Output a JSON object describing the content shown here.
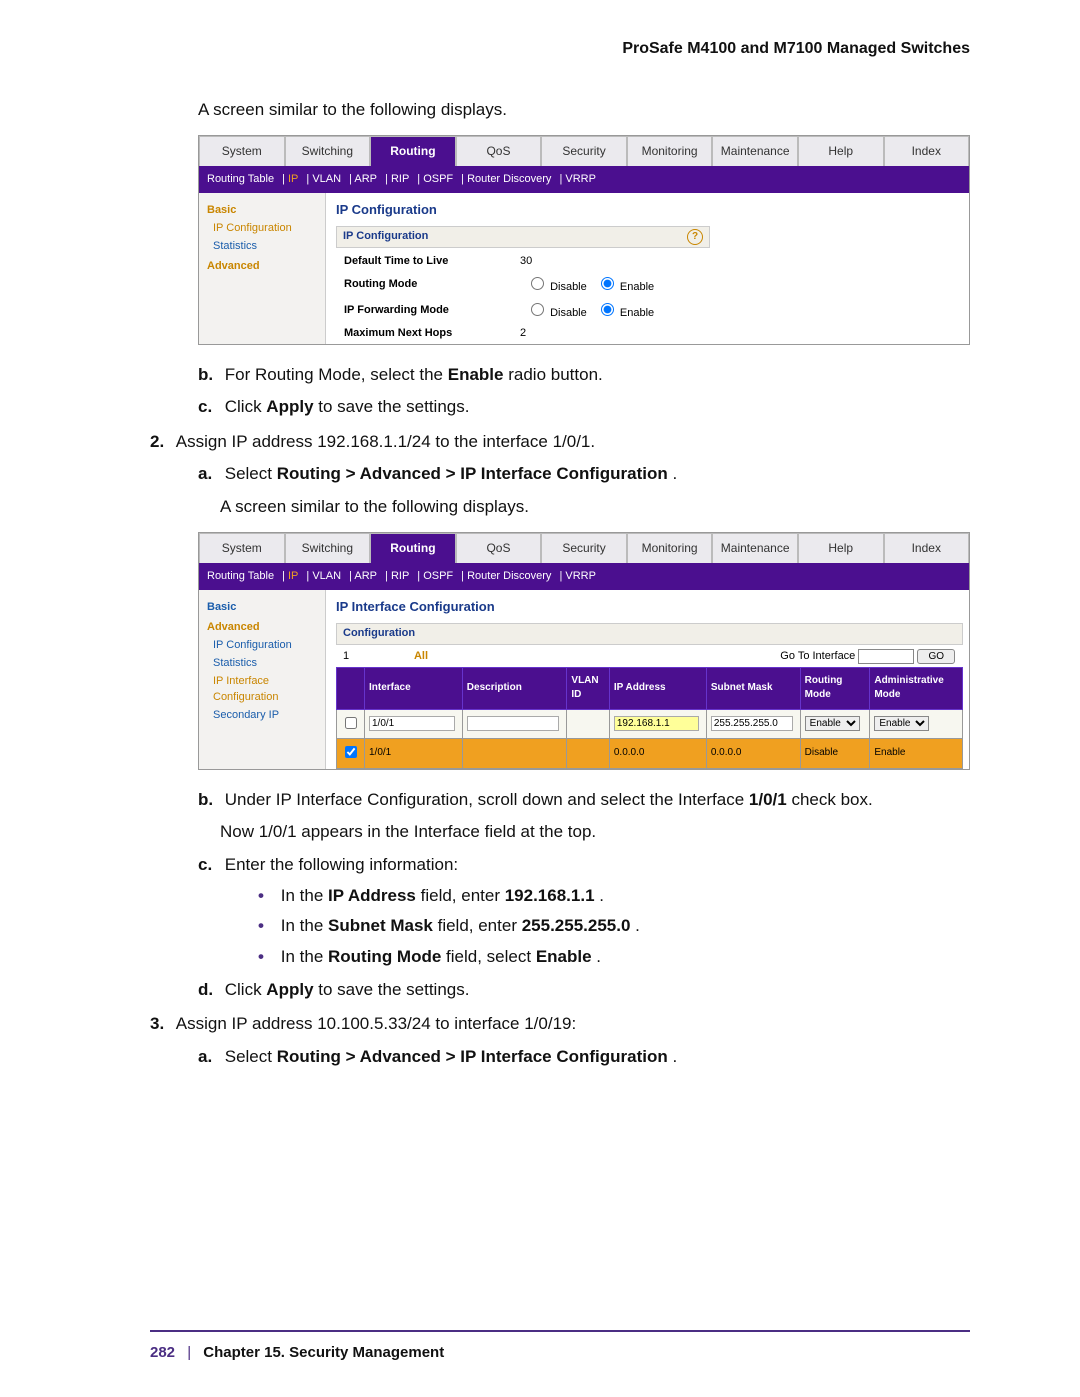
{
  "page": {
    "running_head": "ProSafe M4100 and M7100 Managed Switches",
    "footer_page": "282",
    "footer_chapter": "Chapter 15.  Security Management"
  },
  "text": {
    "intro1": "A screen similar to the following displays.",
    "step_b": "For Routing Mode, select the ",
    "step_b_bold": "Enable",
    "step_b_tail": " radio button.",
    "step_c": "Click ",
    "step_c_bold": "Apply",
    "step_c_tail": " to save the settings.",
    "step2": "Assign IP address 192.168.1.1/24 to the interface 1/0/1.",
    "step2a_pre": "Select ",
    "step2a_bold": "Routing > Advanced > IP Interface Configuration",
    "step2a_post": ".",
    "intro2": "A screen similar to the following displays.",
    "step2b_pre": "Under IP Interface Configuration, scroll down and select the Interface ",
    "step2b_bold": "1/0/1",
    "step2b_post": " check box.",
    "step2b_note": "Now 1/0/1 appears in the Interface field at the top.",
    "step2c": "Enter the following information:",
    "b1_pre": "In the ",
    "b1_bold": "IP Address",
    "b1_mid": " field, enter ",
    "b1_val": "192.168.1.1",
    "b1_post": ".",
    "b2_pre": "In the ",
    "b2_bold": "Subnet Mask",
    "b2_mid": " field, enter ",
    "b2_val": "255.255.255.0",
    "b2_post": ".",
    "b3_pre": "In the ",
    "b3_bold": "Routing Mode",
    "b3_mid": " field, select ",
    "b3_val": "Enable",
    "b3_post": ".",
    "step2d_pre": "Click ",
    "step2d_bold": "Apply",
    "step2d_post": " to save the settings.",
    "step3": "Assign IP address 10.100.5.33/24 to interface 1/0/19:",
    "step3a_pre": "Select ",
    "step3a_bold": "Routing > Advanced > IP Interface Configuration",
    "step3a_post": "."
  },
  "ui_common": {
    "tabs": [
      "System",
      "Switching",
      "Routing",
      "QoS",
      "Security",
      "Monitoring",
      "Maintenance",
      "Help",
      "Index"
    ],
    "subnav": [
      "Routing Table",
      "IP",
      "VLAN",
      "ARP",
      "RIP",
      "OSPF",
      "Router Discovery",
      "VRRP"
    ]
  },
  "ui1": {
    "side": {
      "basic": "Basic",
      "ipconf": "IP Configuration",
      "stats": "Statistics",
      "adv": "Advanced"
    },
    "title": "IP Configuration",
    "group": "IP Configuration",
    "rows": {
      "ttl_label": "Default Time to Live",
      "ttl_val": "30",
      "rm_label": "Routing Mode",
      "fwd_label": "IP Forwarding Mode",
      "mnh_label": "Maximum Next Hops",
      "mnh_val": "2",
      "disable": "Disable",
      "enable": "Enable"
    }
  },
  "ui2": {
    "side": {
      "basic": "Basic",
      "adv": "Advanced",
      "ipconf": "IP Configuration",
      "stats": "Statistics",
      "ipif": "IP Interface Configuration",
      "secip": "Secondary IP"
    },
    "title": "IP Interface Configuration",
    "group": "Configuration",
    "all": "All",
    "goto": "Go To Interface",
    "go": "GO",
    "cols": [
      "",
      "Interface",
      "Description",
      "VLAN ID",
      "IP Address",
      "Subnet Mask",
      "Routing Mode",
      "Administrative Mode"
    ],
    "row_edit": {
      "iface": "1/0/1",
      "ip": "192.168.1.1",
      "mask": "255.255.255.0",
      "rm": "Enable",
      "am": "Enable"
    },
    "row_sel": {
      "iface": "1/0/1",
      "ip": "0.0.0.0",
      "mask": "0.0.0.0",
      "rm": "Disable",
      "am": "Enable"
    }
  }
}
